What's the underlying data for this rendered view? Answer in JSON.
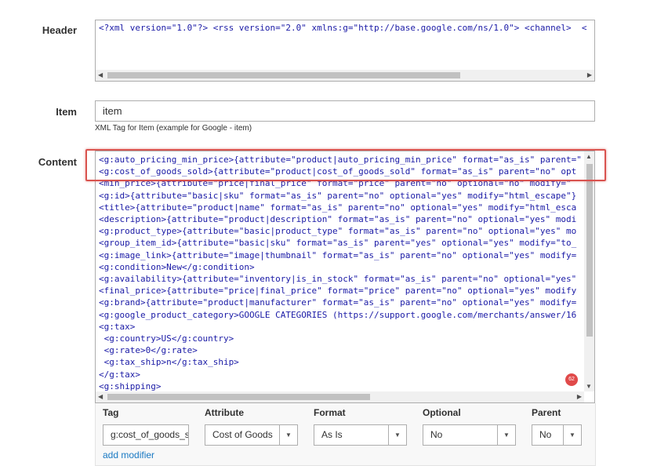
{
  "header": {
    "label": "Header",
    "content": "<?xml version=\"1.0\"?> <rss version=\"2.0\" xmlns:g=\"http://base.google.com/ns/1.0\"> <channel>  <"
  },
  "item": {
    "label": "Item",
    "value": "item",
    "note": "XML Tag for Item (example for Google - item)"
  },
  "content": {
    "label": "Content",
    "notification_count": "62",
    "lines": [
      "<g:auto_pricing_min_price>{attribute=\"product|auto_pricing_min_price\" format=\"as_is\" parent=\"",
      "<g:cost_of_goods_sold>{attribute=\"product|cost_of_goods_sold\" format=\"as_is\" parent=\"no\" opt",
      "<min_price>{attribute=\"price|final_price\" format=\"price\" parent=\"no\" optional=\"no\" modify=\"",
      "<g:id>{attribute=\"basic|sku\" format=\"as_is\" parent=\"no\" optional=\"yes\" modify=\"html_escape\"}",
      "<title>{attribute=\"product|name\" format=\"as_is\" parent=\"no\" optional=\"yes\" modify=\"html_esca",
      "<description>{attribute=\"product|description\" format=\"as_is\" parent=\"no\" optional=\"yes\" modi",
      "<g:product_type>{attribute=\"basic|product_type\" format=\"as_is\" parent=\"no\" optional=\"yes\" mo",
      "<group_item_id>{attribute=\"basic|sku\" format=\"as_is\" parent=\"yes\" optional=\"yes\" modify=\"to_",
      "<g:image_link>{attribute=\"image|thumbnail\" format=\"as_is\" parent=\"no\" optional=\"yes\" modify=",
      "<g:condition>New</g:condition>",
      "<g:availability>{attribute=\"inventory|is_in_stock\" format=\"as_is\" parent=\"no\" optional=\"yes\"",
      "<final_price>{attribute=\"price|final_price\" format=\"price\" parent=\"no\" optional=\"yes\" modify",
      "<g:brand>{attribute=\"product|manufacturer\" format=\"as_is\" parent=\"no\" optional=\"yes\" modify=",
      "<g:google_product_category>GOOGLE CATEGORIES (https://support.google.com/merchants/answer/16",
      "<g:tax>",
      " <g:country>US</g:country>",
      " <g:rate>0</g:rate>",
      " <g:tax_ship>n</g:tax_ship>",
      "</g:tax>",
      "<g:shipping>"
    ]
  },
  "modifier": {
    "columns": [
      "Tag",
      "Attribute",
      "Format",
      "Optional",
      "Parent"
    ],
    "tag_value": "g:cost_of_goods_s",
    "attribute_value": "Cost of Goods",
    "format_value": "As Is",
    "optional_value": "No",
    "parent_value": "No",
    "add_modifier_link": "add modifier"
  },
  "colors": {
    "code_text": "#1a1aa6",
    "highlight": "#d9534f",
    "link": "#1979c3"
  }
}
